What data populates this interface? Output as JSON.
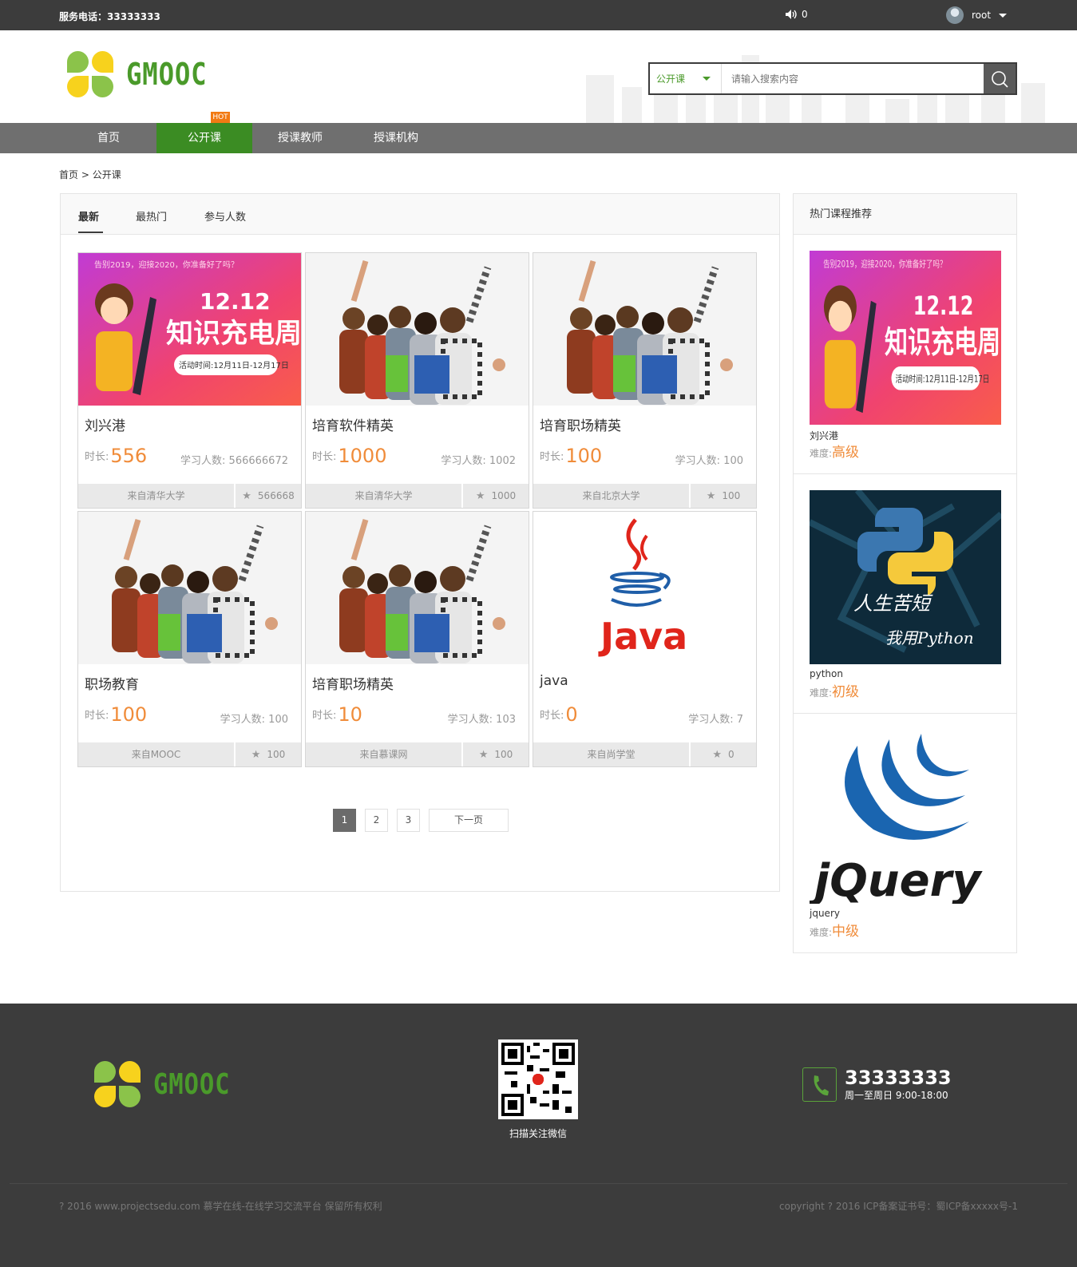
{
  "topbar": {
    "phone_label": "服务电话：",
    "phone": "33333333",
    "msg_count": "0",
    "username": "root"
  },
  "brand": {
    "name": "GMOOC",
    "green": "#4a9a2a",
    "yellow": "#f7d21d"
  },
  "search": {
    "category": "公开课",
    "placeholder": "请输入搜索内容"
  },
  "nav": {
    "items": [
      {
        "label": "首页"
      },
      {
        "label": "公开课"
      },
      {
        "label": "授课教师"
      },
      {
        "label": "授课机构"
      }
    ],
    "hot_badge": "HOT"
  },
  "breadcrumb": {
    "home": "首页",
    "sep": ">",
    "current": "公开课"
  },
  "tabs": [
    "最新",
    "最热门",
    "参与人数"
  ],
  "labels": {
    "duration": "时长:",
    "learners": "学习人数:",
    "difficulty": "难度:"
  },
  "courses": [
    {
      "title": "刘兴港",
      "duration": "556",
      "learners": "566666672",
      "org": "来自清华大学",
      "fav": "566668",
      "image": "banner-1212"
    },
    {
      "title": "培育软件精英",
      "duration": "1000",
      "learners": "1002",
      "org": "来自清华大学",
      "fav": "1000",
      "image": "students"
    },
    {
      "title": "培育职场精英",
      "duration": "100",
      "learners": "100",
      "org": "来自北京大学",
      "fav": "100",
      "image": "students"
    },
    {
      "title": "职场教育",
      "duration": "100",
      "learners": "100",
      "org": "来自MOOC",
      "fav": "100",
      "image": "students"
    },
    {
      "title": "培育职场精英",
      "duration": "10",
      "learners": "103",
      "org": "来自慕课网",
      "fav": "100",
      "image": "students"
    },
    {
      "title": "java",
      "duration": "0",
      "learners": "7",
      "org": "来自尚学堂",
      "fav": "0",
      "image": "java-logo"
    }
  ],
  "banner": {
    "top_line": "告别2019，迎接2020，你准备好了吗？",
    "date": "12.12",
    "headline": "知识充电周",
    "period": "活动时间:12月11日-12月17日"
  },
  "python_art": {
    "line1": "人生苦短",
    "line2": "我用Python"
  },
  "java_logo_text": "Java",
  "jquery_logo_text": "jQuery",
  "pagination": {
    "pages": [
      "1",
      "2",
      "3"
    ],
    "next": "下一页"
  },
  "sidebar": {
    "title": "热门课程推荐",
    "items": [
      {
        "name": "刘兴港",
        "level": "高级",
        "image": "banner-1212"
      },
      {
        "name": "python",
        "level": "初级",
        "image": "python-art"
      },
      {
        "name": "jquery",
        "level": "中级",
        "image": "jquery-logo"
      }
    ]
  },
  "footer": {
    "qr_label": "扫描关注微信",
    "tel": "33333333",
    "hours": "周一至周日 9:00-18:00",
    "copyright_left": "? 2016 www.projectsedu.com 慕学在线-在线学习交流平台 保留所有权利",
    "copyright_right": "copyright ? 2016 ICP备案证书号：蜀ICP备xxxxx号-1"
  },
  "colors": {
    "accent_orange": "#f08c3a",
    "nav_active": "#3b8c23",
    "dark": "#3c3c3c"
  }
}
